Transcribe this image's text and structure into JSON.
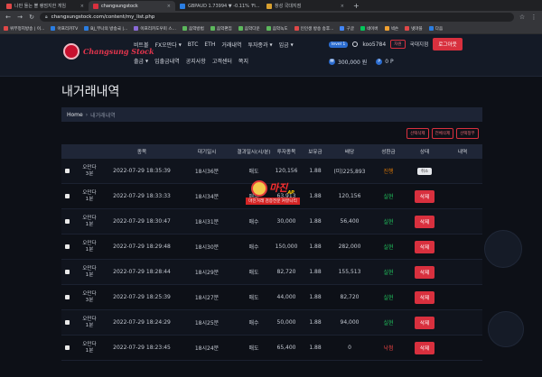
{
  "browser": {
    "tabs": [
      {
        "title": "나만 돌는 뽈 랭덤지한 게임",
        "active": false,
        "color": "#e04848"
      },
      {
        "title": "changsungstock",
        "active": true,
        "color": "#d8303e"
      },
      {
        "title": "GBPAUD 1.73994 ▼ -0.11% 'Fi...",
        "active": false,
        "color": "#2a7de1"
      },
      {
        "title": "창성 국대지점",
        "active": false,
        "color": "#d8a030"
      }
    ],
    "url": "changsungstock.com/content/my_list.php",
    "bookmarks": [
      {
        "label": "위부정지방송 | 이...",
        "color": "#e04848"
      },
      {
        "label": "아프리카TV",
        "color": "#2a7de1"
      },
      {
        "label": "BJ_부나의 방송국 |...",
        "color": "#2a7de1"
      },
      {
        "label": "이프리카도우미 스...",
        "color": "#8a6ad8"
      },
      {
        "label": "음악방법",
        "color": "#5cb85c"
      },
      {
        "label": "음악편집",
        "color": "#5cb85c"
      },
      {
        "label": "음악다운",
        "color": "#5cb85c"
      },
      {
        "label": "음악녹도",
        "color": "#5cb85c"
      },
      {
        "label": "인인생 방송 송후...",
        "color": "#e04848"
      },
      {
        "label": "구글",
        "color": "#4285f4"
      },
      {
        "label": "네이버",
        "color": "#03c75a"
      },
      {
        "label": "넥슨",
        "color": "#f0a030"
      },
      {
        "label": "넷마블",
        "color": "#e04848"
      },
      {
        "label": "다음",
        "color": "#2a7de1"
      }
    ]
  },
  "header": {
    "logo_text": "Changsung Stock",
    "nav_row1": [
      "비트볼",
      "FX오만다",
      "BTC",
      "ETH",
      "거래내역",
      "투자종과",
      "입금"
    ],
    "nav_row1_caret": [
      false,
      true,
      false,
      false,
      false,
      true,
      true
    ],
    "nav_row2": [
      "출금",
      "입출금내역",
      "공지사항",
      "고객센터",
      "쪽지"
    ],
    "nav_row2_caret": [
      true,
      false,
      false,
      false,
      false
    ],
    "level": "level 1",
    "username": "koo5784",
    "badge": "차원",
    "country": "국대지점",
    "logout": "로그아웃",
    "balance": "300,000 원",
    "points": "0 P"
  },
  "page": {
    "title": "내거래내역",
    "breadcrumb_home": "Home",
    "breadcrumb_sep": "›",
    "breadcrumb_current": "내거래내역",
    "filters": [
      "선택삭제",
      "전체삭제",
      "선택정부"
    ]
  },
  "table": {
    "headers": [
      "",
      "종목",
      "대기일시",
      "결과일시(시/분)",
      "투자종목",
      "보유금",
      "배당",
      "성환금",
      "상태",
      "내역"
    ],
    "rows": [
      {
        "round": [
          "오만다",
          "3분"
        ],
        "time": "2022-07-29 18:35:39",
        "result": "18시36분",
        "pick": "매도",
        "amount": "120,156",
        "odds": "1.88",
        "payout": "(미)225,893",
        "status": "진행",
        "status_class": "st-prog",
        "action": "취소"
      },
      {
        "round": [
          "오만다",
          "1분"
        ],
        "time": "2022-07-29 18:33:33",
        "result": "18시34분",
        "pick": "매수",
        "amount": "63,913",
        "odds": "1.88",
        "payout": "120,156",
        "status": "실현",
        "status_class": "st-win",
        "action": "삭제"
      },
      {
        "round": [
          "오만다",
          "1분"
        ],
        "time": "2022-07-29 18:30:47",
        "result": "18시31분",
        "pick": "매수",
        "amount": "30,000",
        "odds": "1.88",
        "payout": "56,400",
        "status": "실현",
        "status_class": "st-win",
        "action": "삭제"
      },
      {
        "round": [
          "오만다",
          "1분"
        ],
        "time": "2022-07-29 18:29:48",
        "result": "18시30분",
        "pick": "매수",
        "amount": "150,000",
        "odds": "1.88",
        "payout": "282,000",
        "status": "실현",
        "status_class": "st-win",
        "action": "삭제"
      },
      {
        "round": [
          "오만다",
          "1분"
        ],
        "time": "2022-07-29 18:28:44",
        "result": "18시29분",
        "pick": "매도",
        "amount": "82,720",
        "odds": "1.88",
        "payout": "155,513",
        "status": "실현",
        "status_class": "st-win",
        "action": "삭제"
      },
      {
        "round": [
          "오만다",
          "3분"
        ],
        "time": "2022-07-29 18:25:39",
        "result": "18시27분",
        "pick": "매도",
        "amount": "44,000",
        "odds": "1.88",
        "payout": "82,720",
        "status": "실현",
        "status_class": "st-win",
        "action": "삭제"
      },
      {
        "round": [
          "오만다",
          "1분"
        ],
        "time": "2022-07-29 18:24:29",
        "result": "18시25분",
        "pick": "매수",
        "amount": "50,000",
        "odds": "1.88",
        "payout": "94,000",
        "status": "실현",
        "status_class": "st-win",
        "action": "삭제"
      },
      {
        "round": [
          "오만다",
          "1분"
        ],
        "time": "2022-07-29 18:23:45",
        "result": "18시24분",
        "pick": "매도",
        "amount": "65,400",
        "odds": "1.88",
        "payout": "0",
        "status": "낙첨",
        "status_class": "st-lose",
        "action": "삭제"
      }
    ]
  },
  "watermark": {
    "title": "마진",
    "title_suffix": "AP",
    "subtitle": "마진거래 검증전문 커뮤니티"
  }
}
